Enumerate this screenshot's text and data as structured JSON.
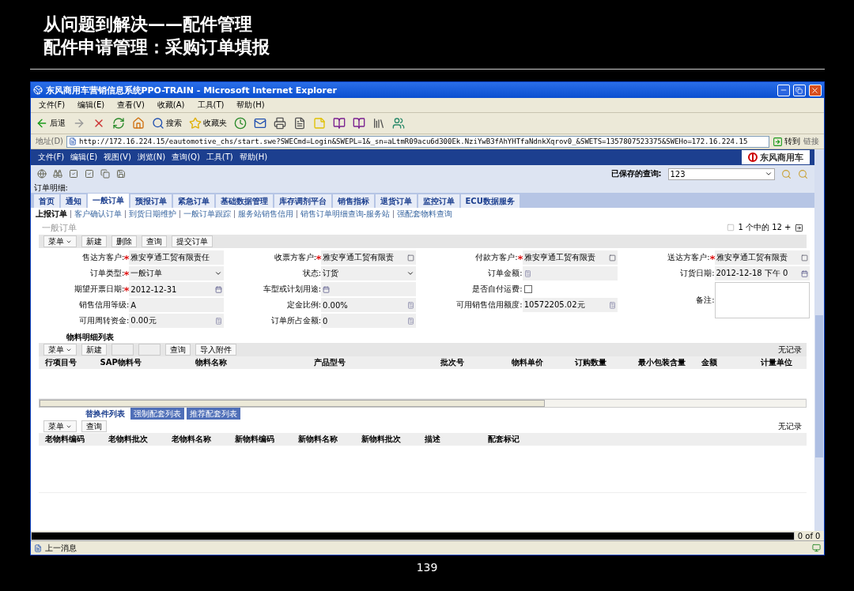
{
  "slide": {
    "heading_lines": [
      "从问题到解决——配件管理",
      "配件申请管理：采购订单填报"
    ],
    "page_number": "139"
  },
  "window": {
    "title": "东风商用车营销信息系统PPO-TRAIN - Microsoft Internet Explorer"
  },
  "ie_menu": [
    "文件(F)",
    "编辑(E)",
    "查看(V)",
    "收藏(A)",
    "工具(T)",
    "帮助(H)"
  ],
  "ie_toolbar": [
    {
      "kind": "back",
      "label": "后退"
    },
    {
      "kind": "forward"
    },
    {
      "kind": "stop"
    },
    {
      "kind": "refresh"
    },
    {
      "kind": "home"
    },
    {
      "kind": "search",
      "label": "搜索"
    },
    {
      "kind": "favorites",
      "label": "收藏夹"
    },
    {
      "kind": "history"
    },
    {
      "kind": "mail"
    },
    {
      "kind": "print"
    },
    {
      "kind": "edit"
    },
    {
      "kind": "note"
    },
    {
      "kind": "book"
    },
    {
      "kind": "book"
    },
    {
      "kind": "library"
    },
    {
      "kind": "users"
    }
  ],
  "address": {
    "label": "地址(D)",
    "url": "http://172.16.224.15/eautomotive_chs/start.swe?SWECmd=Login&SWEPL=1&_sn=aLtmR09acu6d300Ek.NziYwB3fAhYHTfaNdnkXqrov0_&SWETS=1357807523375&SWEHo=172.16.224.15",
    "go": "转到",
    "links": "链接"
  },
  "app_menu": [
    "文件(F)",
    "编辑(E)",
    "视图(V)",
    "浏览(N)",
    "查询(Q)",
    "工具(T)",
    "帮助(H)"
  ],
  "logo": "东风商用车",
  "app_toolbar": [
    {
      "kind": "globe"
    },
    {
      "kind": "binoculars"
    },
    {
      "kind": "check"
    },
    {
      "kind": "check"
    },
    {
      "kind": "copy"
    },
    {
      "kind": "save"
    }
  ],
  "saved_query": {
    "label": "已保存的查询:",
    "value": "123"
  },
  "detail_label": "订单明细:",
  "tabs": [
    {
      "label": "首页",
      "selected": false
    },
    {
      "label": "通知",
      "selected": false
    },
    {
      "label": "一般订单",
      "selected": true
    },
    {
      "label": "预报订单",
      "selected": false
    },
    {
      "label": "紧急订单",
      "selected": false
    },
    {
      "label": "基础数据管理",
      "selected": false
    },
    {
      "label": "库存调剂平台",
      "selected": false
    },
    {
      "label": "销售指标",
      "selected": false
    },
    {
      "label": "退货订单",
      "selected": false
    },
    {
      "label": "监控订单",
      "selected": false
    },
    {
      "label": "ECU数据服务",
      "selected": false
    }
  ],
  "subtabs": [
    {
      "label": "上报订单",
      "selected": true
    },
    {
      "label": "客户确认订单",
      "selected": false
    },
    {
      "label": "到货日期维护",
      "selected": false
    },
    {
      "label": "一般订单跟踪",
      "selected": false
    },
    {
      "label": "服务站销售信用",
      "selected": false
    },
    {
      "label": "销售订单明细查询-服务站",
      "selected": false
    },
    {
      "label": "强配套物料查询",
      "selected": false
    }
  ],
  "form_title": "一般订单",
  "pager": "1 个中的 12 +",
  "form_buttons": [
    {
      "kind": "menu",
      "label": "菜单"
    },
    {
      "kind": "button",
      "label": "新建"
    },
    {
      "kind": "button",
      "label": "删除"
    },
    {
      "kind": "button",
      "label": "查询"
    },
    {
      "kind": "button",
      "label": "提交订单"
    }
  ],
  "form": {
    "columns": [
      [
        {
          "label": "售达方客户:",
          "required": true,
          "kind": "text",
          "value": "雅安亨通工贸有限责任"
        },
        {
          "label": "订单类型:",
          "required": true,
          "kind": "select",
          "value": "一般订单"
        },
        {
          "label": "期望开票日期:",
          "required": true,
          "kind": "date",
          "value": "2012-12-31"
        },
        {
          "label": "销售信用等级:",
          "required": false,
          "kind": "text",
          "value": "A"
        },
        {
          "label": "可用周转资金:",
          "required": false,
          "kind": "calc",
          "value": "0.00元"
        }
      ],
      [
        {
          "label": "收票方客户:",
          "required": true,
          "kind": "pick",
          "value": "雅安亨通工贸有限责"
        },
        {
          "label": "状态:",
          "required": false,
          "kind": "select",
          "value": "订货"
        },
        {
          "label": "车型或计划用途:",
          "required": false,
          "kind": "date"
        },
        {
          "label": "定金比例:",
          "required": false,
          "kind": "calc",
          "value": "0.00%"
        },
        {
          "label": "订单所占金额:",
          "required": false,
          "kind": "calc",
          "value": "0"
        }
      ],
      [
        {
          "label": "付款方客户:",
          "required": true,
          "kind": "pick",
          "value": "雅安亨通工贸有限责"
        },
        {
          "label": "订单金额:",
          "required": false,
          "kind": "calc"
        },
        {
          "label": "是否自付运费:",
          "required": false,
          "kind": "check",
          "checked": false
        },
        {
          "label": "可用销售信用额度:",
          "required": false,
          "kind": "calc",
          "value": "10572205.02元"
        }
      ],
      [
        {
          "label": "送达方客户:",
          "required": true,
          "kind": "pick",
          "value": "雅安亨通工贸有限责"
        },
        {
          "label": "订货日期:",
          "required": false,
          "kind": "date",
          "value": "2012-12-18 下午 0"
        },
        {
          "label": "备注:",
          "required": false,
          "kind": "textarea"
        }
      ]
    ]
  },
  "materials": {
    "title": "物料明细列表",
    "buttons": [
      {
        "kind": "menu",
        "label": "菜单"
      },
      {
        "kind": "button",
        "label": "新建"
      },
      {
        "kind": "blank"
      },
      {
        "kind": "blank"
      },
      {
        "kind": "button",
        "label": "查询"
      },
      {
        "kind": "button",
        "label": "导入附件"
      }
    ],
    "count": "无记录",
    "columns": [
      "行项目号",
      "SAP物料号",
      "物料名称",
      "产品型号",
      "批次号",
      "物料单价",
      "订购数量",
      "最小包装含量",
      "金额",
      "计量单位"
    ]
  },
  "replacements": {
    "tabs": [
      {
        "label": "替换件列表",
        "selected": true
      },
      {
        "label": "强制配套列表",
        "selected": false
      },
      {
        "label": "推荐配套列表",
        "selected": false
      }
    ],
    "buttons": [
      {
        "kind": "menu",
        "label": "菜单"
      },
      {
        "kind": "button",
        "label": "查询"
      }
    ],
    "count": "无记录",
    "columns": [
      "老物料编码",
      "老物料批次",
      "老物料名称",
      "新物料编码",
      "新物料名称",
      "新物料批次",
      "描述",
      "配套标记"
    ]
  },
  "record_pager": "0 of 0",
  "status_bar": {
    "text": "上一消息"
  }
}
